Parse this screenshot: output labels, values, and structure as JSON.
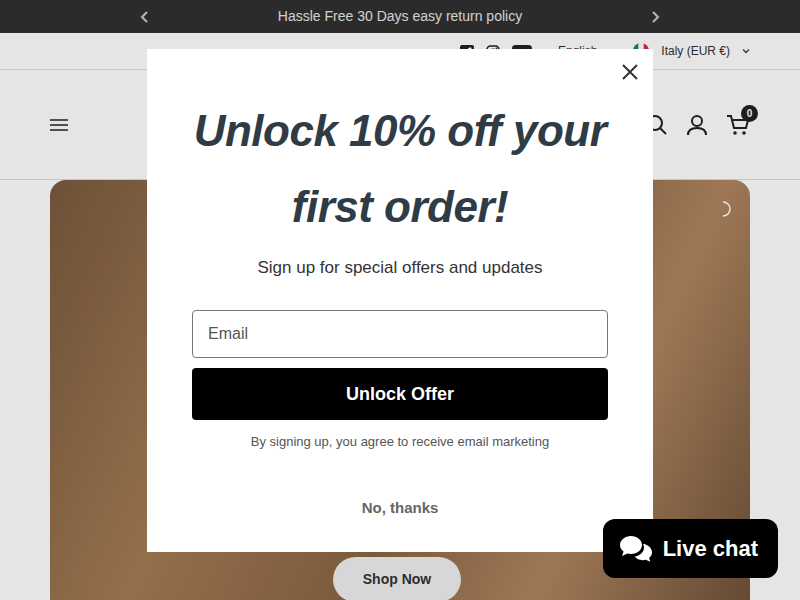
{
  "announcement": {
    "text": "Hassle Free 30 Days easy return policy"
  },
  "utility_bar": {
    "language": "English",
    "currency": "Italy (EUR €)"
  },
  "cart": {
    "count": "0"
  },
  "hero": {
    "button": "Shop Now"
  },
  "popup": {
    "title": "Unlock 10% off your first order!",
    "subtitle": "Sign up for special offers and updates",
    "email_placeholder": "Email",
    "submit": "Unlock Offer",
    "disclaimer": "By signing up, you agree to receive email marketing",
    "decline": "No, thanks"
  },
  "chat": {
    "label": "Live chat"
  }
}
